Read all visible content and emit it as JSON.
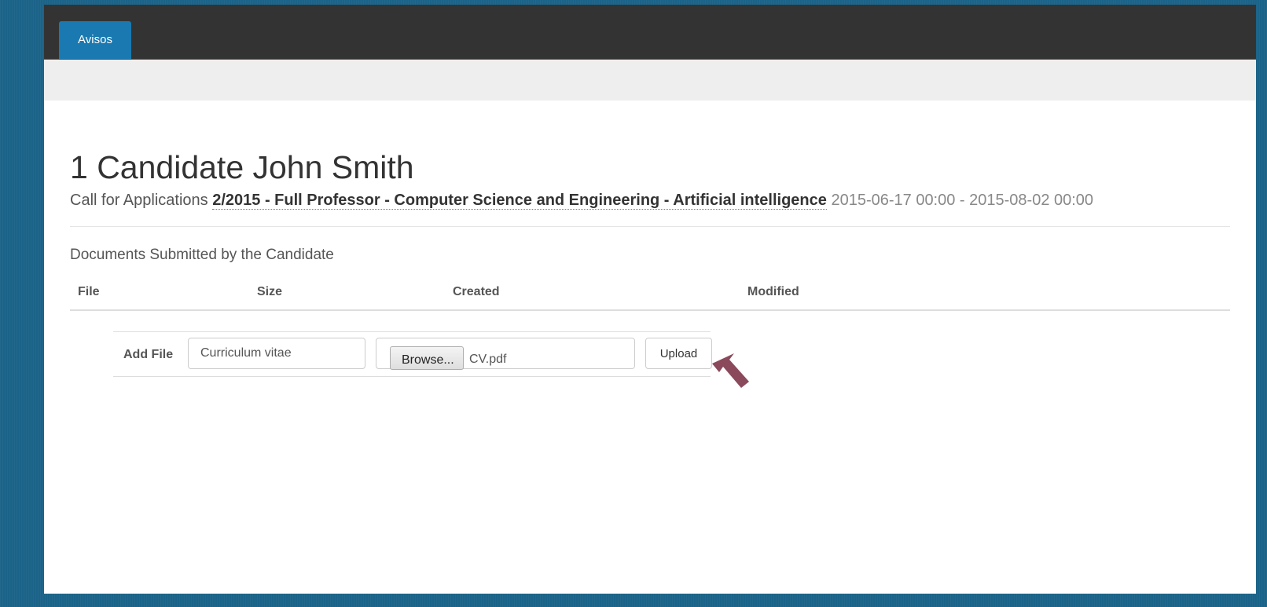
{
  "nav": {
    "tab_label": "Avisos"
  },
  "page": {
    "title": "1 Candidate John Smith",
    "call_prefix": "Call for Applications",
    "call_title": "2/2015 - Full Professor - Computer Science and Engineering - Artificial intelligence",
    "call_dates": "2015-06-17 00:00 - 2015-08-02 00:00"
  },
  "documents": {
    "section_title": "Documents Submitted by the Candidate",
    "columns": [
      "File",
      "Size",
      "Created",
      "Modified"
    ],
    "rows": []
  },
  "add_file": {
    "label": "Add File",
    "name_value": "Curriculum vitae",
    "browse_label": "Browse...",
    "selected_file": "CV.pdf",
    "upload_label": "Upload"
  },
  "colors": {
    "accent": "#1a79b1",
    "topbar": "#333333",
    "background": "#1b6388",
    "pointer": "#8a4a5c"
  },
  "icons": {
    "pointer": "arrow-pointer-icon"
  }
}
